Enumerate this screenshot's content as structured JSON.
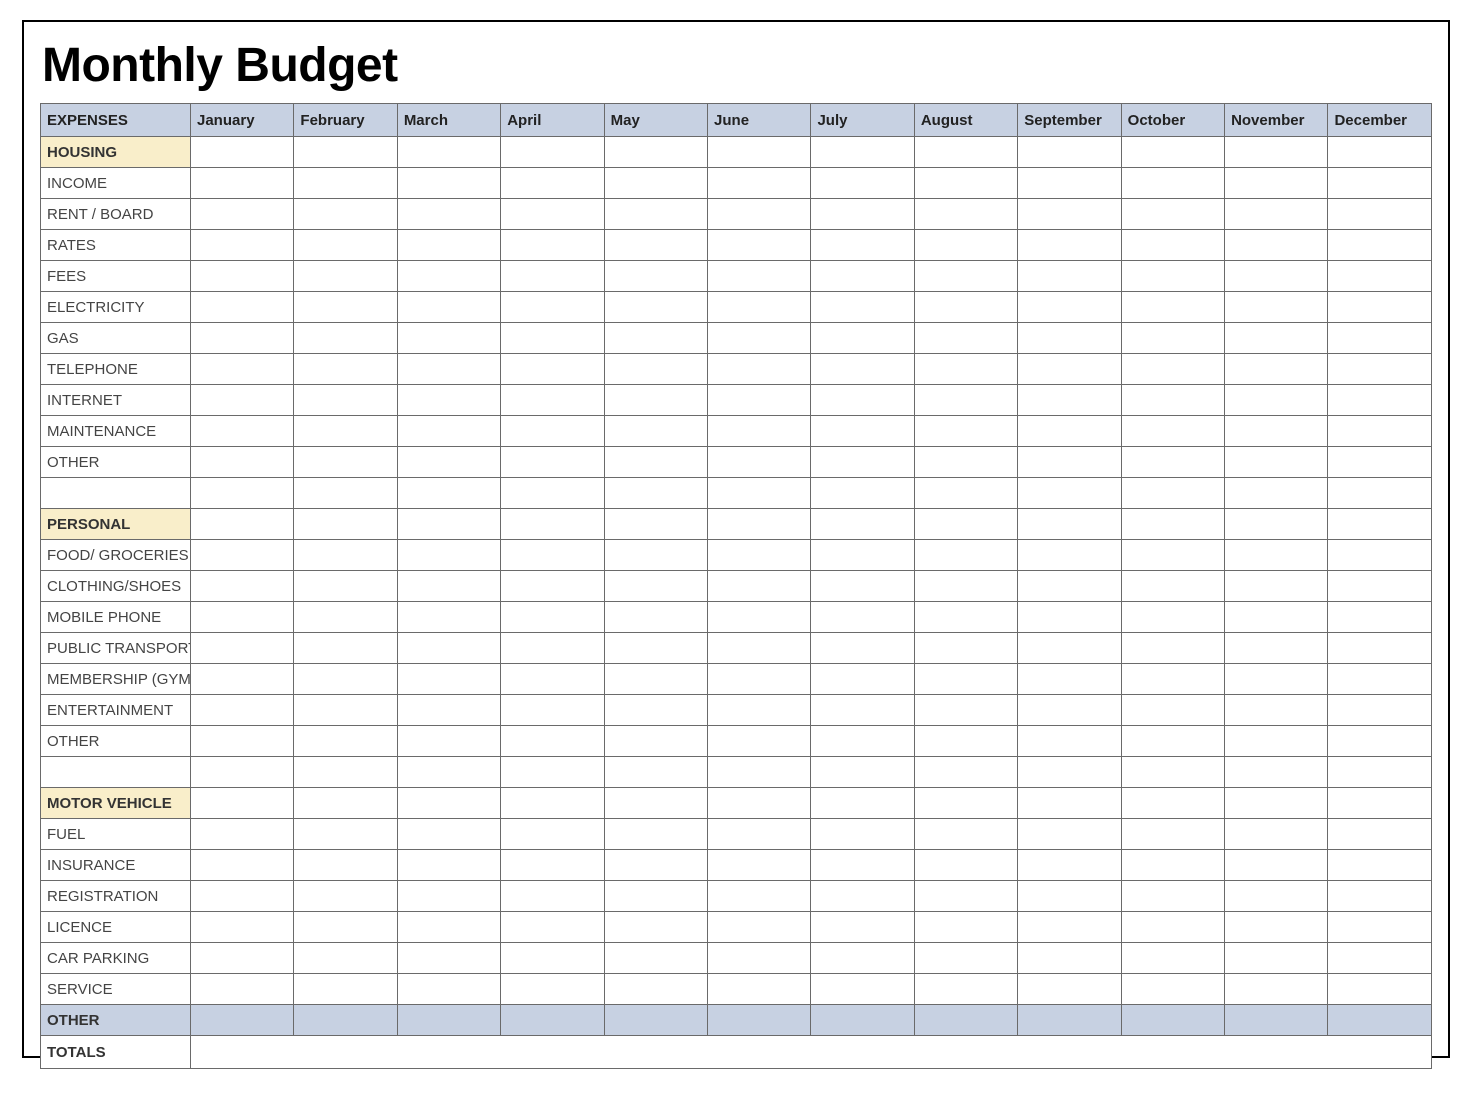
{
  "title": "Monthly Budget",
  "header_label": "EXPENSES",
  "months": [
    "January",
    "February",
    "March",
    "April",
    "May",
    "June",
    "July",
    "August",
    "September",
    "October",
    "November",
    "December"
  ],
  "rows": [
    {
      "type": "category",
      "label": "HOUSING"
    },
    {
      "type": "item",
      "label": "INCOME"
    },
    {
      "type": "item",
      "label": "RENT / BOARD"
    },
    {
      "type": "item",
      "label": "RATES"
    },
    {
      "type": "item",
      "label": "FEES"
    },
    {
      "type": "item",
      "label": "ELECTRICITY"
    },
    {
      "type": "item",
      "label": "GAS"
    },
    {
      "type": "item",
      "label": "TELEPHONE"
    },
    {
      "type": "item",
      "label": "INTERNET"
    },
    {
      "type": "item",
      "label": "MAINTENANCE"
    },
    {
      "type": "item",
      "label": "OTHER"
    },
    {
      "type": "blank",
      "label": ""
    },
    {
      "type": "category",
      "label": "PERSONAL"
    },
    {
      "type": "item",
      "label": "FOOD/ GROCERIES"
    },
    {
      "type": "item",
      "label": "CLOTHING/SHOES"
    },
    {
      "type": "item",
      "label": "MOBILE PHONE"
    },
    {
      "type": "item",
      "label": "PUBLIC TRANSPORT"
    },
    {
      "type": "item",
      "label": "MEMBERSHIP (GYM)"
    },
    {
      "type": "item",
      "label": "ENTERTAINMENT"
    },
    {
      "type": "item",
      "label": "OTHER"
    },
    {
      "type": "blank",
      "label": ""
    },
    {
      "type": "category",
      "label": "MOTOR VEHICLE"
    },
    {
      "type": "item",
      "label": "FUEL"
    },
    {
      "type": "item",
      "label": "INSURANCE"
    },
    {
      "type": "item",
      "label": "REGISTRATION"
    },
    {
      "type": "item",
      "label": "LICENCE"
    },
    {
      "type": "item",
      "label": "CAR PARKING"
    },
    {
      "type": "item",
      "label": "SERVICE"
    }
  ],
  "other_label": "OTHER",
  "totals_label": "TOTALS"
}
